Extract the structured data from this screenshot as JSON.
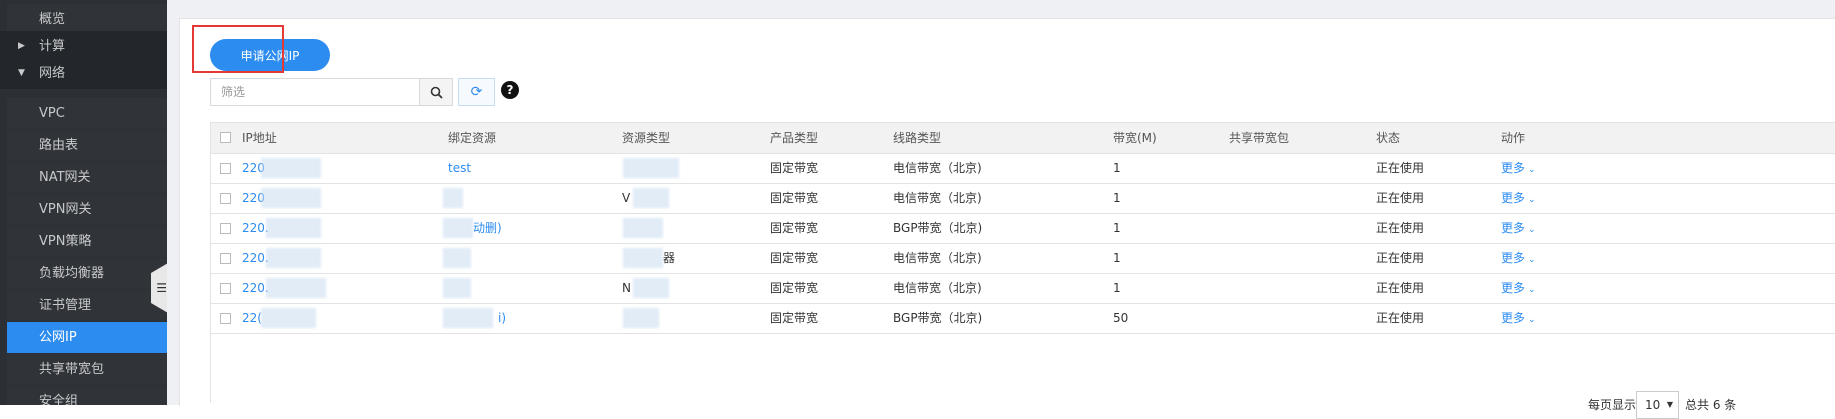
{
  "sidebar": {
    "items": [
      {
        "label": "概览",
        "type": "sub"
      },
      {
        "label": "计算",
        "type": "parent-collapsed"
      },
      {
        "label": "网络",
        "type": "parent-expanded"
      },
      {
        "label": "VPC",
        "type": "sub"
      },
      {
        "label": "路由表",
        "type": "sub"
      },
      {
        "label": "NAT网关",
        "type": "sub"
      },
      {
        "label": "VPN网关",
        "type": "sub"
      },
      {
        "label": "VPN策略",
        "type": "sub"
      },
      {
        "label": "负载均衡器",
        "type": "sub"
      },
      {
        "label": "证书管理",
        "type": "sub"
      },
      {
        "label": "公网IP",
        "type": "active"
      },
      {
        "label": "共享带宽包",
        "type": "sub"
      },
      {
        "label": "安全组",
        "type": "sub"
      }
    ],
    "collapse_icon": "menu-collapse-icon"
  },
  "toolbar": {
    "apply_label": "申请公网IP",
    "filter_placeholder": "筛选",
    "search_icon": "search-icon",
    "refresh_icon": "refresh-icon",
    "help_icon": "question-circle-icon",
    "help_glyph": "?"
  },
  "table": {
    "columns": [
      "IP地址",
      "绑定资源",
      "资源类型",
      "产品类型",
      "线路类型",
      "带宽(M)",
      "共享带宽包",
      "状态",
      "动作"
    ],
    "rows": [
      {
        "ip": "220",
        "resource": "test",
        "resource_type": "",
        "product": "固定带宽",
        "line": "电信带宽（北京)",
        "bandwidth": "1",
        "shared": "",
        "status": "正在使用",
        "action": "更多"
      },
      {
        "ip": "220",
        "resource": "",
        "resource_type": "V",
        "product": "固定带宽",
        "line": "电信带宽（北京)",
        "bandwidth": "1",
        "shared": "",
        "status": "正在使用",
        "action": "更多"
      },
      {
        "ip": "220.",
        "resource": "动删)",
        "resource_type": "",
        "product": "固定带宽",
        "line": "BGP带宽（北京)",
        "bandwidth": "1",
        "shared": "",
        "status": "正在使用",
        "action": "更多"
      },
      {
        "ip": "220.",
        "resource": "",
        "resource_type": "器",
        "product": "固定带宽",
        "line": "电信带宽（北京)",
        "bandwidth": "1",
        "shared": "",
        "status": "正在使用",
        "action": "更多"
      },
      {
        "ip": "220.",
        "resource": "",
        "resource_type": "N",
        "product": "固定带宽",
        "line": "电信带宽（北京)",
        "bandwidth": "1",
        "shared": "",
        "status": "正在使用",
        "action": "更多"
      },
      {
        "ip": "22(",
        "resource": "i)",
        "resource_type": "",
        "product": "固定带宽",
        "line": "BGP带宽（北京)",
        "bandwidth": "50",
        "shared": "",
        "status": "正在使用",
        "action": "更多"
      }
    ]
  },
  "pagination": {
    "per_page_label": "每页显示",
    "page_size": "10",
    "total_label": "总共 6 条"
  },
  "colors": {
    "accent": "#2d8cf0",
    "sidebar_bg": "#2c2f33",
    "highlight_border": "#e53935"
  }
}
